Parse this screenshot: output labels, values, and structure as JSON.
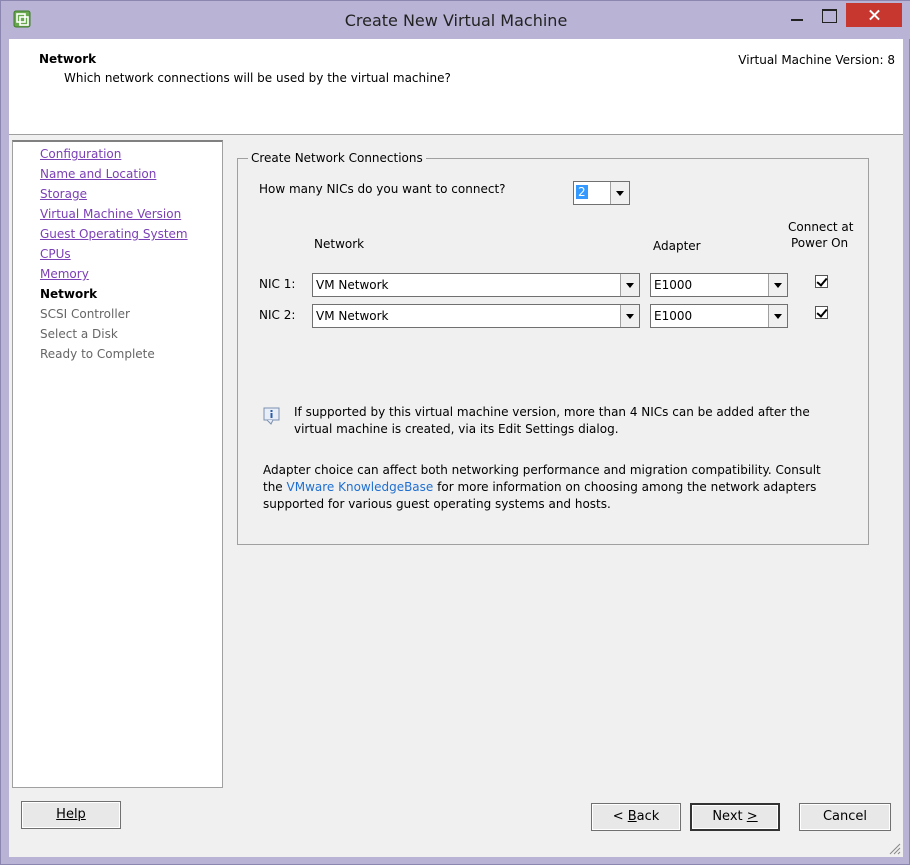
{
  "window": {
    "title": "Create New Virtual Machine",
    "icon": "vm-app-icon"
  },
  "header": {
    "title": "Network",
    "subtitle": "Which network connections will be used by the virtual machine?",
    "version": "Virtual Machine Version: 8"
  },
  "sidebar": {
    "steps": [
      {
        "label": "Configuration",
        "state": "done"
      },
      {
        "label": "Name and Location",
        "state": "done"
      },
      {
        "label": "Storage",
        "state": "done"
      },
      {
        "label": "Virtual Machine Version",
        "state": "done"
      },
      {
        "label": "Guest Operating System",
        "state": "done"
      },
      {
        "label": "CPUs",
        "state": "done"
      },
      {
        "label": "Memory",
        "state": "done"
      },
      {
        "label": "Network",
        "state": "current"
      },
      {
        "label": "SCSI Controller",
        "state": "pending"
      },
      {
        "label": "Select a Disk",
        "state": "pending"
      },
      {
        "label": "Ready to Complete",
        "state": "pending"
      }
    ]
  },
  "connections": {
    "group_title": "Create Network Connections",
    "nics_question": "How many NICs do you want to connect?",
    "nics_count": "2",
    "col_network": "Network",
    "col_adapter": "Adapter",
    "col_connect_line1": "Connect at",
    "col_connect_line2": "Power On",
    "nics": [
      {
        "label": "NIC 1:",
        "network": "VM Network",
        "adapter": "E1000",
        "connect": true
      },
      {
        "label": "NIC 2:",
        "network": "VM Network",
        "adapter": "E1000",
        "connect": true
      }
    ]
  },
  "info": {
    "line1": "If supported by this virtual machine version, more than 4 NICs can be added after the",
    "line2": "virtual machine is created, via its Edit Settings dialog."
  },
  "adapter_note": {
    "line1": "Adapter choice can affect both networking performance and migration compatibility. Consult",
    "line2_pre": "the ",
    "link": "VMware KnowledgeBase",
    "line2_post": " for more information on choosing among the network adapters",
    "line3": "supported for various guest operating systems and hosts."
  },
  "buttons": {
    "help": "Help",
    "back_hotkey": "B",
    "back_rest": "ack",
    "back_prefix": "< ",
    "next_label": "Next ",
    "next_hotkey": ">",
    "cancel": "Cancel"
  }
}
